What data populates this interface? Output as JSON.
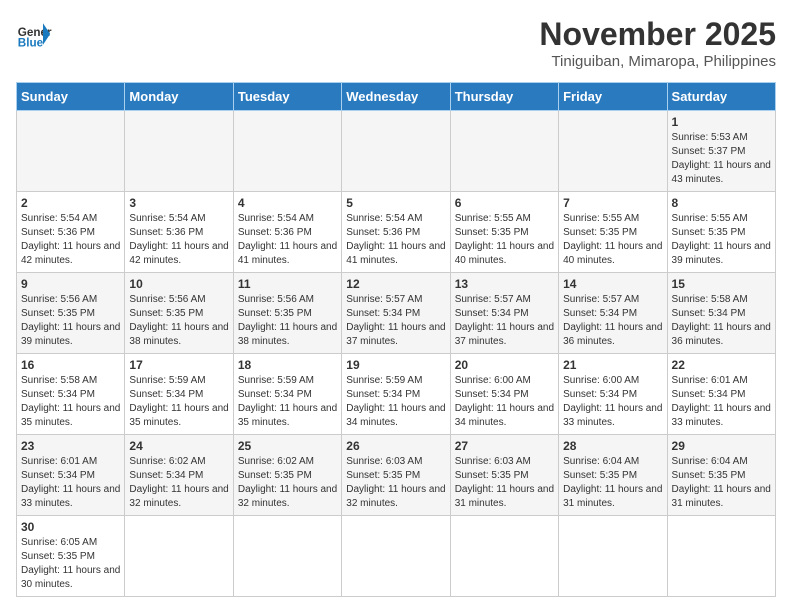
{
  "header": {
    "logo_general": "General",
    "logo_blue": "Blue",
    "month": "November 2025",
    "location": "Tiniguiban, Mimaropa, Philippines"
  },
  "days_of_week": [
    "Sunday",
    "Monday",
    "Tuesday",
    "Wednesday",
    "Thursday",
    "Friday",
    "Saturday"
  ],
  "weeks": [
    [
      {
        "day": "",
        "info": ""
      },
      {
        "day": "",
        "info": ""
      },
      {
        "day": "",
        "info": ""
      },
      {
        "day": "",
        "info": ""
      },
      {
        "day": "",
        "info": ""
      },
      {
        "day": "",
        "info": ""
      },
      {
        "day": "1",
        "info": "Sunrise: 5:53 AM\nSunset: 5:37 PM\nDaylight: 11 hours\nand 43 minutes."
      }
    ],
    [
      {
        "day": "2",
        "info": "Sunrise: 5:54 AM\nSunset: 5:36 PM\nDaylight: 11 hours\nand 42 minutes."
      },
      {
        "day": "3",
        "info": "Sunrise: 5:54 AM\nSunset: 5:36 PM\nDaylight: 11 hours\nand 42 minutes."
      },
      {
        "day": "4",
        "info": "Sunrise: 5:54 AM\nSunset: 5:36 PM\nDaylight: 11 hours\nand 41 minutes."
      },
      {
        "day": "5",
        "info": "Sunrise: 5:54 AM\nSunset: 5:36 PM\nDaylight: 11 hours\nand 41 minutes."
      },
      {
        "day": "6",
        "info": "Sunrise: 5:55 AM\nSunset: 5:35 PM\nDaylight: 11 hours\nand 40 minutes."
      },
      {
        "day": "7",
        "info": "Sunrise: 5:55 AM\nSunset: 5:35 PM\nDaylight: 11 hours\nand 40 minutes."
      },
      {
        "day": "8",
        "info": "Sunrise: 5:55 AM\nSunset: 5:35 PM\nDaylight: 11 hours\nand 39 minutes."
      }
    ],
    [
      {
        "day": "9",
        "info": "Sunrise: 5:56 AM\nSunset: 5:35 PM\nDaylight: 11 hours\nand 39 minutes."
      },
      {
        "day": "10",
        "info": "Sunrise: 5:56 AM\nSunset: 5:35 PM\nDaylight: 11 hours\nand 38 minutes."
      },
      {
        "day": "11",
        "info": "Sunrise: 5:56 AM\nSunset: 5:35 PM\nDaylight: 11 hours\nand 38 minutes."
      },
      {
        "day": "12",
        "info": "Sunrise: 5:57 AM\nSunset: 5:34 PM\nDaylight: 11 hours\nand 37 minutes."
      },
      {
        "day": "13",
        "info": "Sunrise: 5:57 AM\nSunset: 5:34 PM\nDaylight: 11 hours\nand 37 minutes."
      },
      {
        "day": "14",
        "info": "Sunrise: 5:57 AM\nSunset: 5:34 PM\nDaylight: 11 hours\nand 36 minutes."
      },
      {
        "day": "15",
        "info": "Sunrise: 5:58 AM\nSunset: 5:34 PM\nDaylight: 11 hours\nand 36 minutes."
      }
    ],
    [
      {
        "day": "16",
        "info": "Sunrise: 5:58 AM\nSunset: 5:34 PM\nDaylight: 11 hours\nand 35 minutes."
      },
      {
        "day": "17",
        "info": "Sunrise: 5:59 AM\nSunset: 5:34 PM\nDaylight: 11 hours\nand 35 minutes."
      },
      {
        "day": "18",
        "info": "Sunrise: 5:59 AM\nSunset: 5:34 PM\nDaylight: 11 hours\nand 35 minutes."
      },
      {
        "day": "19",
        "info": "Sunrise: 5:59 AM\nSunset: 5:34 PM\nDaylight: 11 hours\nand 34 minutes."
      },
      {
        "day": "20",
        "info": "Sunrise: 6:00 AM\nSunset: 5:34 PM\nDaylight: 11 hours\nand 34 minutes."
      },
      {
        "day": "21",
        "info": "Sunrise: 6:00 AM\nSunset: 5:34 PM\nDaylight: 11 hours\nand 33 minutes."
      },
      {
        "day": "22",
        "info": "Sunrise: 6:01 AM\nSunset: 5:34 PM\nDaylight: 11 hours\nand 33 minutes."
      }
    ],
    [
      {
        "day": "23",
        "info": "Sunrise: 6:01 AM\nSunset: 5:34 PM\nDaylight: 11 hours\nand 33 minutes."
      },
      {
        "day": "24",
        "info": "Sunrise: 6:02 AM\nSunset: 5:34 PM\nDaylight: 11 hours\nand 32 minutes."
      },
      {
        "day": "25",
        "info": "Sunrise: 6:02 AM\nSunset: 5:35 PM\nDaylight: 11 hours\nand 32 minutes."
      },
      {
        "day": "26",
        "info": "Sunrise: 6:03 AM\nSunset: 5:35 PM\nDaylight: 11 hours\nand 32 minutes."
      },
      {
        "day": "27",
        "info": "Sunrise: 6:03 AM\nSunset: 5:35 PM\nDaylight: 11 hours\nand 31 minutes."
      },
      {
        "day": "28",
        "info": "Sunrise: 6:04 AM\nSunset: 5:35 PM\nDaylight: 11 hours\nand 31 minutes."
      },
      {
        "day": "29",
        "info": "Sunrise: 6:04 AM\nSunset: 5:35 PM\nDaylight: 11 hours\nand 31 minutes."
      }
    ],
    [
      {
        "day": "30",
        "info": "Sunrise: 6:05 AM\nSunset: 5:35 PM\nDaylight: 11 hours\nand 30 minutes."
      },
      {
        "day": "",
        "info": ""
      },
      {
        "day": "",
        "info": ""
      },
      {
        "day": "",
        "info": ""
      },
      {
        "day": "",
        "info": ""
      },
      {
        "day": "",
        "info": ""
      },
      {
        "day": "",
        "info": ""
      }
    ]
  ]
}
